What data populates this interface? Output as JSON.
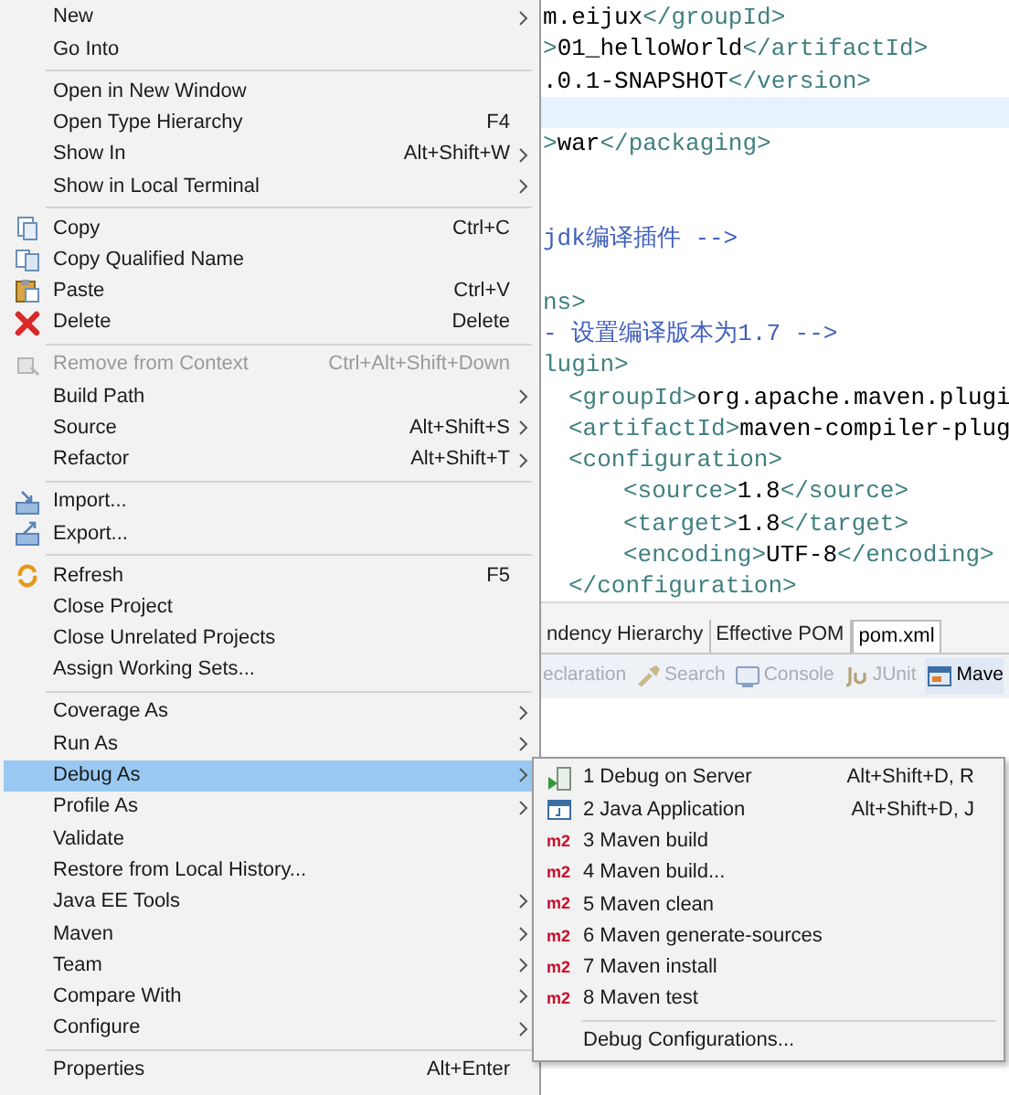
{
  "editor": {
    "lines": [
      {
        "kind": "top",
        "segments": [
          {
            "kind": "text",
            "text": "m.eijux"
          },
          {
            "kind": "tag",
            "text": "</groupId>"
          }
        ]
      },
      {
        "kind": "top",
        "segments": [
          {
            "kind": "tag",
            "text": ">"
          },
          {
            "kind": "text",
            "text": "01_helloWorld"
          },
          {
            "kind": "tag",
            "text": "</artifactId>"
          }
        ]
      },
      {
        "kind": "top",
        "segments": [
          {
            "kind": "text",
            "text": ".0.1-SNAPSHOT"
          },
          {
            "kind": "tag",
            "text": "</version>"
          }
        ]
      },
      {
        "kind": "cursor_line"
      },
      {
        "kind": "top",
        "segments": [
          {
            "kind": "tag",
            "text": ">"
          },
          {
            "kind": "text",
            "text": "war"
          },
          {
            "kind": "tag",
            "text": "</packaging>"
          }
        ]
      },
      {
        "kind": "blank"
      },
      {
        "kind": "blank"
      },
      {
        "kind": "top",
        "segments": [
          {
            "kind": "comment",
            "text": "jdk编译插件 -->"
          }
        ]
      },
      {
        "kind": "blank"
      },
      {
        "kind": "top",
        "segments": [
          {
            "kind": "tag",
            "text": "ns>"
          }
        ]
      },
      {
        "kind": "top",
        "segments": [
          {
            "kind": "comment",
            "text": "- 设置编译版本为1.7 -->"
          }
        ]
      },
      {
        "kind": "top",
        "segments": [
          {
            "kind": "tag",
            "text": "lugin>"
          }
        ]
      },
      {
        "kind": "nested",
        "segments": [
          {
            "kind": "tag",
            "text": "<groupId>"
          },
          {
            "kind": "text",
            "text": "org.apache.maven.plugi"
          }
        ]
      },
      {
        "kind": "nested",
        "segments": [
          {
            "kind": "tag",
            "text": "<artifactId>"
          },
          {
            "kind": "text",
            "text": "maven-compiler-plug"
          }
        ]
      },
      {
        "kind": "nested",
        "segments": [
          {
            "kind": "tag",
            "text": "<configuration>"
          }
        ]
      },
      {
        "kind": "deep",
        "segments": [
          {
            "kind": "tag",
            "text": "<source>"
          },
          {
            "kind": "text",
            "text": "1.8"
          },
          {
            "kind": "tag",
            "text": "</source>"
          }
        ]
      },
      {
        "kind": "deep",
        "segments": [
          {
            "kind": "tag",
            "text": "<target>"
          },
          {
            "kind": "text",
            "text": "1.8"
          },
          {
            "kind": "tag",
            "text": "</target>"
          }
        ]
      },
      {
        "kind": "deep",
        "segments": [
          {
            "kind": "tag",
            "text": "<encoding>"
          },
          {
            "kind": "text",
            "text": "UTF-8"
          },
          {
            "kind": "tag",
            "text": "</encoding>"
          }
        ]
      },
      {
        "kind": "nested",
        "segments": [
          {
            "kind": "tag",
            "text": "</configuration>"
          }
        ]
      }
    ],
    "tabs": [
      {
        "label": "ndency Hierarchy",
        "selected": false
      },
      {
        "label": "Effective POM",
        "selected": false
      },
      {
        "label": "pom.xml",
        "selected": true
      }
    ]
  },
  "views": [
    {
      "kind": "plain",
      "label": "eclaration",
      "active": false
    },
    {
      "kind": "search",
      "label": "Search",
      "active": false
    },
    {
      "kind": "console",
      "label": "Console",
      "active": false
    },
    {
      "kind": "junit",
      "label": "JUnit",
      "active": false
    },
    {
      "kind": "maven",
      "label": "Mave",
      "active": true
    }
  ],
  "context_menu": [
    {
      "kind": "item",
      "label": "New",
      "submenu": true,
      "selected": false,
      "disabled": false
    },
    {
      "kind": "item",
      "label": "Go Into",
      "submenu": false,
      "selected": false,
      "disabled": false
    },
    {
      "kind": "separator"
    },
    {
      "kind": "item",
      "label": "Open in New Window",
      "submenu": false,
      "selected": false,
      "disabled": false
    },
    {
      "kind": "item",
      "label": "Open Type Hierarchy",
      "shortcut": "F4",
      "submenu": false,
      "selected": false,
      "disabled": false
    },
    {
      "kind": "item",
      "label": "Show In",
      "shortcut": "Alt+Shift+W",
      "submenu": true,
      "selected": false,
      "disabled": false
    },
    {
      "kind": "item",
      "label": "Show in Local Terminal",
      "submenu": true,
      "selected": false,
      "disabled": false
    },
    {
      "kind": "separator"
    },
    {
      "kind": "copy",
      "label": "Copy",
      "shortcut": "Ctrl+C",
      "submenu": false,
      "selected": false,
      "disabled": false
    },
    {
      "kind": "copy2",
      "label": "Copy Qualified Name",
      "submenu": false,
      "selected": false,
      "disabled": false
    },
    {
      "kind": "paste",
      "label": "Paste",
      "shortcut": "Ctrl+V",
      "submenu": false,
      "selected": false,
      "disabled": false
    },
    {
      "kind": "delete",
      "label": "Delete",
      "shortcut": "Delete",
      "submenu": false,
      "selected": false,
      "disabled": false
    },
    {
      "kind": "separator"
    },
    {
      "kind": "remove",
      "label": "Remove from Context",
      "shortcut": "Ctrl+Alt+Shift+Down",
      "submenu": false,
      "selected": false,
      "disabled": true
    },
    {
      "kind": "item",
      "label": "Build Path",
      "submenu": true,
      "selected": false,
      "disabled": false
    },
    {
      "kind": "item",
      "label": "Source",
      "shortcut": "Alt+Shift+S",
      "submenu": true,
      "selected": false,
      "disabled": false
    },
    {
      "kind": "item",
      "label": "Refactor",
      "shortcut": "Alt+Shift+T",
      "submenu": true,
      "selected": false,
      "disabled": false
    },
    {
      "kind": "separator"
    },
    {
      "kind": "import",
      "label": "Import...",
      "submenu": false,
      "selected": false,
      "disabled": false
    },
    {
      "kind": "export",
      "label": "Export...",
      "submenu": false,
      "selected": false,
      "disabled": false
    },
    {
      "kind": "separator"
    },
    {
      "kind": "refresh",
      "label": "Refresh",
      "shortcut": "F5",
      "submenu": false,
      "selected": false,
      "disabled": false
    },
    {
      "kind": "item",
      "label": "Close Project",
      "submenu": false,
      "selected": false,
      "disabled": false
    },
    {
      "kind": "item",
      "label": "Close Unrelated Projects",
      "submenu": false,
      "selected": false,
      "disabled": false
    },
    {
      "kind": "item",
      "label": "Assign Working Sets...",
      "submenu": false,
      "selected": false,
      "disabled": false
    },
    {
      "kind": "separator"
    },
    {
      "kind": "item",
      "label": "Coverage As",
      "submenu": true,
      "selected": false,
      "disabled": false
    },
    {
      "kind": "item",
      "label": "Run As",
      "submenu": true,
      "selected": false,
      "disabled": false
    },
    {
      "kind": "item",
      "label": "Debug As",
      "submenu": true,
      "selected": true,
      "disabled": false
    },
    {
      "kind": "item",
      "label": "Profile As",
      "submenu": true,
      "selected": false,
      "disabled": false
    },
    {
      "kind": "item",
      "label": "Validate",
      "submenu": false,
      "selected": false,
      "disabled": false
    },
    {
      "kind": "item",
      "label": "Restore from Local History...",
      "submenu": false,
      "selected": false,
      "disabled": false
    },
    {
      "kind": "item",
      "label": "Java EE Tools",
      "submenu": true,
      "selected": false,
      "disabled": false
    },
    {
      "kind": "item",
      "label": "Maven",
      "submenu": true,
      "selected": false,
      "disabled": false
    },
    {
      "kind": "item",
      "label": "Team",
      "submenu": true,
      "selected": false,
      "disabled": false
    },
    {
      "kind": "item",
      "label": "Compare With",
      "submenu": true,
      "selected": false,
      "disabled": false
    },
    {
      "kind": "item",
      "label": "Configure",
      "submenu": true,
      "selected": false,
      "disabled": false
    },
    {
      "kind": "separator"
    },
    {
      "kind": "item",
      "label": "Properties",
      "shortcut": "Alt+Enter",
      "submenu": false,
      "selected": false,
      "disabled": false
    }
  ],
  "debug_submenu": [
    {
      "kind": "server",
      "label": "1 Debug on Server",
      "shortcut": "Alt+Shift+D, R"
    },
    {
      "kind": "java",
      "label": "2 Java Application",
      "shortcut": "Alt+Shift+D, J"
    },
    {
      "kind": "m2",
      "label": "3 Maven build",
      "icon_text": "m2"
    },
    {
      "kind": "m2",
      "label": "4 Maven build...",
      "icon_text": "m2"
    },
    {
      "kind": "m2",
      "label": "5 Maven clean",
      "icon_text": "m2"
    },
    {
      "kind": "m2",
      "label": "6 Maven generate-sources",
      "icon_text": "m2"
    },
    {
      "kind": "m2",
      "label": "7 Maven install",
      "icon_text": "m2"
    },
    {
      "kind": "m2",
      "label": "8 Maven test",
      "icon_text": "m2"
    },
    {
      "kind": "separator"
    },
    {
      "kind": "item",
      "label": "Debug Configurations..."
    }
  ]
}
